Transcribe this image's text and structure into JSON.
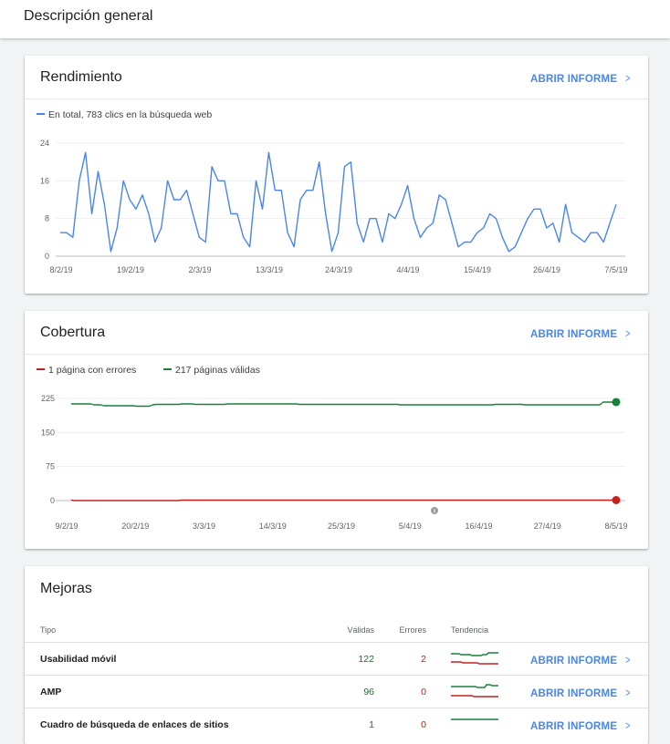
{
  "header": {
    "title": "Descripción general"
  },
  "rendimiento": {
    "title": "Rendimiento",
    "open_label": "ABRIR INFORME",
    "legend": "En total, 783 clics en la búsqueda web",
    "line_color": "#4a86e8"
  },
  "cobertura": {
    "title": "Cobertura",
    "open_label": "ABRIR INFORME",
    "legend_errors": "1 página con errores",
    "legend_valid": "217 páginas válidas",
    "error_color": "#c5221f",
    "valid_color": "#188038"
  },
  "mejoras": {
    "title": "Mejoras",
    "columns": {
      "tipo": "Tipo",
      "validas": "Válidas",
      "errores": "Errores",
      "tendencia": "Tendencia"
    },
    "rows": [
      {
        "name": "Usabilidad móvil",
        "valid": "122",
        "errors": "2",
        "open_label": "ABRIR INFORME"
      },
      {
        "name": "AMP",
        "valid": "96",
        "errors": "0",
        "open_label": "ABRIR INFORME"
      },
      {
        "name": "Cuadro de búsqueda de enlaces de sitios",
        "valid": "1",
        "errors": "0",
        "open_label": "ABRIR INFORME"
      }
    ]
  },
  "chart_data": [
    {
      "type": "line",
      "ylim": [
        0,
        24
      ],
      "yticks": [
        0,
        8,
        16,
        24
      ],
      "xtick_labels": [
        "8/2/19",
        "19/2/19",
        "2/3/19",
        "13/3/19",
        "24/3/19",
        "4/4/19",
        "15/4/19",
        "26/4/19",
        "7/5/19"
      ],
      "series": [
        {
          "name": "En total, 783 clics en la búsqueda web",
          "color": "#4a86e8",
          "values": [
            5,
            5,
            4,
            16,
            22,
            9,
            18,
            11,
            1,
            6,
            16,
            12,
            10,
            13,
            9,
            3,
            6,
            16,
            12,
            12,
            14,
            9,
            4,
            3,
            19,
            16,
            16,
            9,
            9,
            4,
            2,
            16,
            10,
            22,
            14,
            14,
            5,
            2,
            12,
            14,
            14,
            20,
            9,
            1,
            5,
            19,
            20,
            7,
            3,
            8,
            8,
            3,
            9,
            8,
            11,
            15,
            8,
            4,
            6,
            7,
            13,
            12,
            7,
            2,
            3,
            3,
            5,
            6,
            9,
            8,
            4,
            1,
            2,
            5,
            8,
            10,
            10,
            6,
            7,
            3,
            11,
            5,
            4,
            3,
            5,
            5,
            3,
            7,
            11
          ]
        }
      ]
    },
    {
      "type": "line",
      "ylim": [
        0,
        225
      ],
      "yticks": [
        0,
        75,
        150,
        225
      ],
      "xtick_labels": [
        "9/2/19",
        "20/2/19",
        "3/3/19",
        "14/3/19",
        "25/3/19",
        "5/4/19",
        "16/4/19",
        "27/4/19",
        "8/5/19"
      ],
      "series": [
        {
          "name": "217 páginas válidas",
          "color": "#188038",
          "values": [
            213,
            213,
            213,
            213,
            213,
            213,
            213,
            211,
            211,
            211,
            209,
            209,
            209,
            209,
            209,
            209,
            209,
            209,
            209,
            209,
            208,
            208,
            208,
            208,
            208,
            211,
            212,
            212,
            212,
            212,
            212,
            212,
            212,
            212,
            213,
            213,
            213,
            213,
            212,
            212,
            212,
            212,
            212,
            212,
            212,
            212,
            212,
            212,
            213,
            213,
            213,
            213,
            213,
            213,
            213,
            213,
            213,
            213,
            213,
            213,
            213,
            213,
            213,
            213,
            213,
            213,
            213,
            213,
            213,
            213,
            212,
            212,
            212,
            212,
            212,
            212,
            212,
            212,
            212,
            212,
            212,
            212,
            212,
            212,
            212,
            212,
            212,
            212,
            212,
            212,
            212,
            212,
            212,
            212,
            212,
            212,
            212,
            212,
            212,
            212,
            212,
            211,
            211,
            211,
            211,
            211,
            211,
            211,
            211,
            211,
            211,
            211,
            211,
            211,
            211,
            211,
            211,
            211,
            211,
            211,
            211,
            211,
            211,
            211,
            211,
            211,
            211,
            211,
            211,
            211,
            212,
            212,
            212,
            212,
            212,
            212,
            212,
            212,
            212,
            211,
            211,
            211,
            211,
            211,
            211,
            211,
            211,
            211,
            211,
            211,
            211,
            211,
            211,
            211,
            211,
            211,
            211,
            211,
            211,
            211,
            211,
            211,
            211,
            217,
            217,
            217,
            217,
            217
          ]
        },
        {
          "name": "1 página con errores",
          "color": "#c5221f",
          "values": [
            1,
            0,
            0,
            0,
            0,
            0,
            0,
            0,
            0,
            0,
            0,
            0,
            0,
            0,
            0,
            0,
            0,
            0,
            0,
            0,
            0,
            0,
            0,
            0,
            0,
            0,
            0,
            0,
            0,
            0,
            0,
            0,
            0,
            0,
            1,
            1,
            1,
            1,
            1,
            1,
            1,
            1,
            1,
            1,
            1,
            1,
            1,
            1,
            1,
            1,
            1,
            1,
            1,
            1,
            1,
            1,
            1,
            1,
            1,
            1,
            1,
            1,
            1,
            1,
            1,
            1,
            1,
            1,
            1,
            1,
            1,
            1,
            1,
            1,
            1,
            1,
            1,
            1,
            1,
            1,
            1,
            1,
            1,
            1,
            1,
            1,
            1,
            1,
            1,
            1,
            1,
            1,
            1,
            1,
            1,
            1,
            1,
            1,
            1,
            1,
            1,
            1,
            1,
            1,
            1,
            1,
            1,
            1,
            1,
            1,
            1,
            1,
            1,
            1,
            1,
            1,
            1,
            1,
            1,
            1,
            1,
            1,
            1,
            1,
            1,
            1,
            1,
            1,
            1,
            1,
            1,
            1,
            1,
            1,
            1,
            1,
            1,
            1,
            1,
            1,
            1,
            1,
            1,
            1,
            1,
            1,
            1,
            1,
            1,
            1,
            1,
            1,
            1,
            1,
            1,
            1,
            1,
            1,
            1,
            1,
            1,
            1,
            1,
            1,
            1,
            1,
            1,
            1,
            1
          ]
        }
      ]
    }
  ]
}
